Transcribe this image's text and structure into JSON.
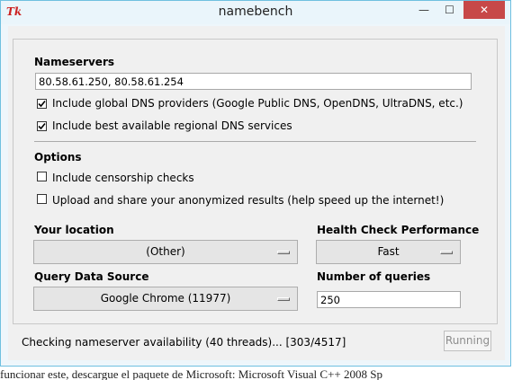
{
  "window": {
    "title": "namebench",
    "icon_text": "Tk",
    "controls": {
      "minimize": "—",
      "maximize": "☐",
      "close": "✕"
    }
  },
  "nameservers": {
    "heading": "Nameservers",
    "value": "80.58.61.250, 80.58.61.254",
    "include_global_label": "Include global DNS providers (Google Public DNS, OpenDNS, UltraDNS, etc.)",
    "include_global_checked": true,
    "include_regional_label": "Include best available regional DNS services",
    "include_regional_checked": true
  },
  "options": {
    "heading": "Options",
    "censorship_label": "Include censorship checks",
    "censorship_checked": false,
    "upload_label": "Upload and share your anonymized results (help speed up the internet!)",
    "upload_checked": false
  },
  "location": {
    "heading": "Your location",
    "selected": "(Other)"
  },
  "health": {
    "heading": "Health Check Performance",
    "selected": "Fast"
  },
  "query_source": {
    "heading": "Query Data Source",
    "selected": "Google Chrome (11977)"
  },
  "num_queries": {
    "heading": "Number of queries",
    "value": "250"
  },
  "status": {
    "text": "Checking nameserver availability (40 threads)... [303/4517]",
    "button_label": "Running"
  },
  "background_text": "funcionar este, descargue el paquete de Microsoft: Microsoft Visual C++ 2008 Sp"
}
